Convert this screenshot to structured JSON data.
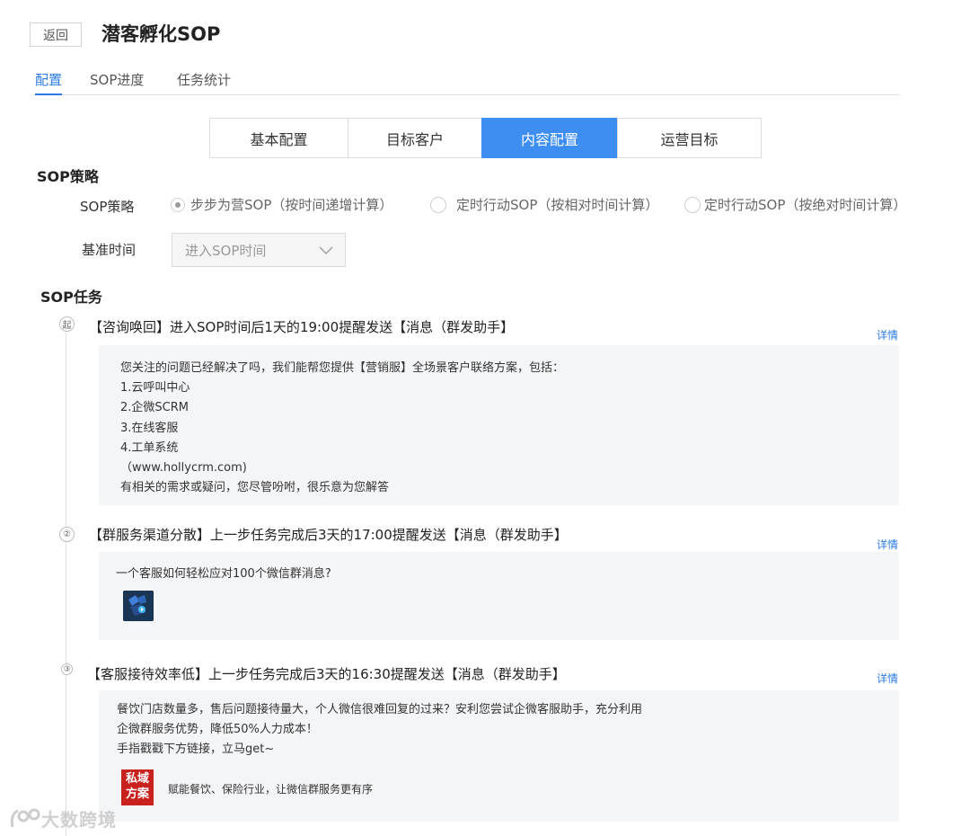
{
  "header": {
    "back_label": "返回",
    "title": "潜客孵化SOP"
  },
  "tabs": [
    {
      "label": "配置",
      "active": true
    },
    {
      "label": "SOP进度",
      "active": false
    },
    {
      "label": "任务统计",
      "active": false
    }
  ],
  "steps": [
    {
      "label": "基本配置",
      "active": false
    },
    {
      "label": "目标客户",
      "active": false
    },
    {
      "label": "内容配置",
      "active": true
    },
    {
      "label": "运营目标",
      "active": false
    }
  ],
  "strategy": {
    "section_title": "SOP策略",
    "label": "SOP策略",
    "options": [
      {
        "label": "步步为营SOP（按时间递增计算）",
        "checked": true
      },
      {
        "label": "定时行动SOP（按相对时间计算）",
        "checked": false
      },
      {
        "label": "定时行动SOP（按绝对时间计算）",
        "checked": false
      }
    ],
    "base_time_label": "基准时间",
    "base_time_value": "进入SOP时间"
  },
  "tasks": {
    "section_title": "SOP任务",
    "detail_label": "详情",
    "items": [
      {
        "badge": "起",
        "title": "【咨询唤回】进入SOP时间后1天的19:00提醒发送【消息（群发助手】",
        "lines": [
          "您关注的问题已经解决了吗，我们能帮您提供【营销服】全场景客户联络方案，包括：",
          "1.云呼叫中心",
          "2.企微SCRM",
          "3.在线客服",
          "4.工单系统",
          "（www.hollycrm.com)",
          "有相关的需求或疑问，您尽管吩咐，很乐意为您解答"
        ]
      },
      {
        "badge": "②",
        "title": "【群服务渠道分散】上一步任务完成后3天的17:00提醒发送【消息（群发助手】",
        "lines": [
          "一个客服如何轻松应对100个微信群消息?"
        ]
      },
      {
        "badge": "③",
        "title": "【客服接待效率低】上一步任务完成后3天的16:30提醒发送【消息（群发助手】",
        "lines": [
          "餐饮门店数量多，售后问题接待量大，个人微信很难回复的过来？安利您尝试企微客服助手，充分利用",
          "企微群服务优势，降低50%人力成本！",
          "手指戳戳下方链接，立马get~"
        ],
        "attachment_logo_text": "私域方案",
        "attachment_caption": "赋能餐饮、保险行业，让微信群服务更有序"
      }
    ]
  },
  "watermark": "大数跨境"
}
